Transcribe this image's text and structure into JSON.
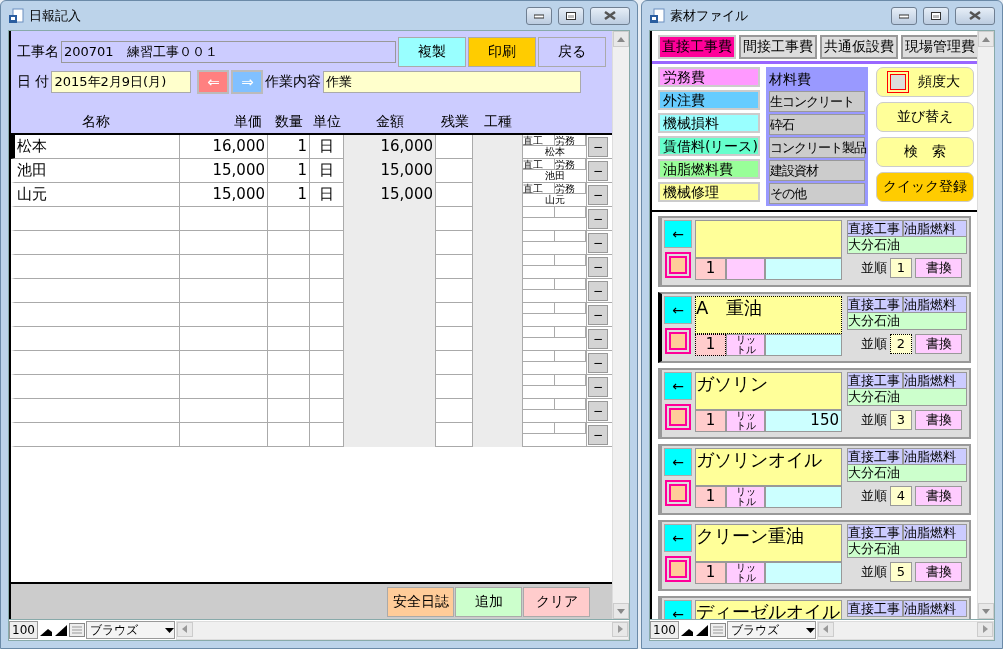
{
  "daily_report": {
    "title": "日報記入",
    "project": {
      "label": "工事名",
      "value": "200701　練習工事００１"
    },
    "top_buttons": [
      {
        "label": "複製",
        "color": "#99ffff"
      },
      {
        "label": "印刷",
        "color": "#ffcc00"
      },
      {
        "label": "戻る",
        "color": "#ccccff"
      }
    ],
    "date": {
      "label": "日 付",
      "value": "2015年2月9日(月)"
    },
    "prev_button": "⇐",
    "next_button": "⇒",
    "work": {
      "label": "作業内容",
      "value": "作業"
    },
    "columns": [
      "名称",
      "単価",
      "数量",
      "単位",
      "金額",
      "残業",
      "工種"
    ],
    "rows": [
      {
        "kind": "filled",
        "current": true,
        "name": "松本",
        "unit_price": "16,000",
        "quantity": "1",
        "unit": "日",
        "amount": "16,000",
        "tag_1": "直工",
        "tag_2": "労務",
        "tag_name": "松本",
        "delete": "−"
      },
      {
        "kind": "filled",
        "current": false,
        "name": "池田",
        "unit_price": "15,000",
        "quantity": "1",
        "unit": "日",
        "amount": "15,000",
        "tag_1": "直工",
        "tag_2": "労務",
        "tag_name": "池田",
        "delete": "−"
      },
      {
        "kind": "filled",
        "current": false,
        "name": "山元",
        "unit_price": "15,000",
        "quantity": "1",
        "unit": "日",
        "amount": "15,000",
        "tag_1": "直工",
        "tag_2": "労務",
        "tag_name": "山元",
        "delete": "−"
      },
      {
        "kind": "blank",
        "current": false,
        "delete": "−"
      },
      {
        "kind": "blank",
        "current": false,
        "delete": "−"
      },
      {
        "kind": "blank",
        "current": false,
        "delete": "−"
      },
      {
        "kind": "blank",
        "current": false,
        "delete": "−"
      },
      {
        "kind": "blank",
        "current": false,
        "delete": "−"
      },
      {
        "kind": "blank",
        "current": false,
        "delete": "−"
      },
      {
        "kind": "blank",
        "current": false,
        "delete": "−"
      },
      {
        "kind": "blank",
        "current": false,
        "delete": "−"
      },
      {
        "kind": "blank",
        "current": false,
        "delete": "−"
      },
      {
        "kind": "blank",
        "current": false,
        "delete": "−"
      }
    ],
    "footer_buttons": [
      {
        "label": "安全日誌",
        "color": "#ffcc99"
      },
      {
        "label": "追加",
        "color": "#ccffcc"
      },
      {
        "label": "クリア",
        "color": "#ffcccc"
      }
    ],
    "status_bar": {
      "zoom": "100",
      "mode": "ブラウズ"
    }
  },
  "material_file": {
    "title": "素材ファイル",
    "tabs": [
      {
        "label": "直接工事費",
        "selected": true
      },
      {
        "label": "間接工事費",
        "selected": false
      },
      {
        "label": "共通仮設費",
        "selected": false
      },
      {
        "label": "現場管理費",
        "selected": false
      }
    ],
    "categories": [
      {
        "label": "労務費",
        "color": "#ff99ff"
      },
      {
        "label": "外注費",
        "color": "#66ccff"
      },
      {
        "label": "機械損料",
        "color": "#99ffff"
      },
      {
        "label": "賃借料(リース)",
        "color": "#66ffcc"
      },
      {
        "label": "油脂燃料費",
        "color": "#99ff99"
      },
      {
        "label": "機械修理",
        "color": "#ffff99"
      }
    ],
    "materials": {
      "title": "材料費",
      "items": [
        "生コンクリート",
        "砕石",
        "コンクリート製品",
        "建設資材",
        "その他"
      ]
    },
    "frequency": {
      "label": "頻度大",
      "checked": false
    },
    "side_buttons": [
      {
        "label": "並び替え",
        "color": "#ffff99"
      },
      {
        "label": "検　索",
        "color": "#ffff99"
      },
      {
        "label": "クイック登録",
        "color": "#ffcc00"
      }
    ],
    "records": [
      {
        "current": false,
        "arrow": "←",
        "quantity": "1",
        "tag_1": "直接工事",
        "tag_2": "油脂燃料",
        "supplier": "大分石油",
        "order_label": "並順",
        "order": "1",
        "rewrite": "書換"
      },
      {
        "current": true,
        "arrow": "←",
        "name": "A　重油",
        "quantity": "1",
        "unit": "リットル",
        "tag_1": "直接工事",
        "tag_2": "油脂燃料",
        "supplier": "大分石油",
        "order_label": "並順",
        "order": "2",
        "rewrite": "書換"
      },
      {
        "current": false,
        "arrow": "←",
        "name": "ガソリン",
        "quantity": "1",
        "unit": "リットル",
        "amount": "150",
        "tag_1": "直接工事",
        "tag_2": "油脂燃料",
        "supplier": "大分石油",
        "order_label": "並順",
        "order": "3",
        "rewrite": "書換"
      },
      {
        "current": false,
        "arrow": "←",
        "name": "ガソリンオイル",
        "quantity": "1",
        "unit": "リットル",
        "tag_1": "直接工事",
        "tag_2": "油脂燃料",
        "supplier": "大分石油",
        "order_label": "並順",
        "order": "4",
        "rewrite": "書換"
      },
      {
        "current": false,
        "arrow": "←",
        "name": "クリーン重油",
        "quantity": "1",
        "unit": "リットル",
        "tag_1": "直接工事",
        "tag_2": "油脂燃料",
        "supplier": "大分石油",
        "order_label": "並順",
        "order": "5",
        "rewrite": "書換"
      },
      {
        "current": false,
        "arrow": "←",
        "name": "ディーゼルオイル",
        "tag_1": "直接工事",
        "tag_2": "油脂燃料"
      }
    ],
    "status_bar": {
      "zoom": "100",
      "mode": "ブラウズ"
    }
  }
}
